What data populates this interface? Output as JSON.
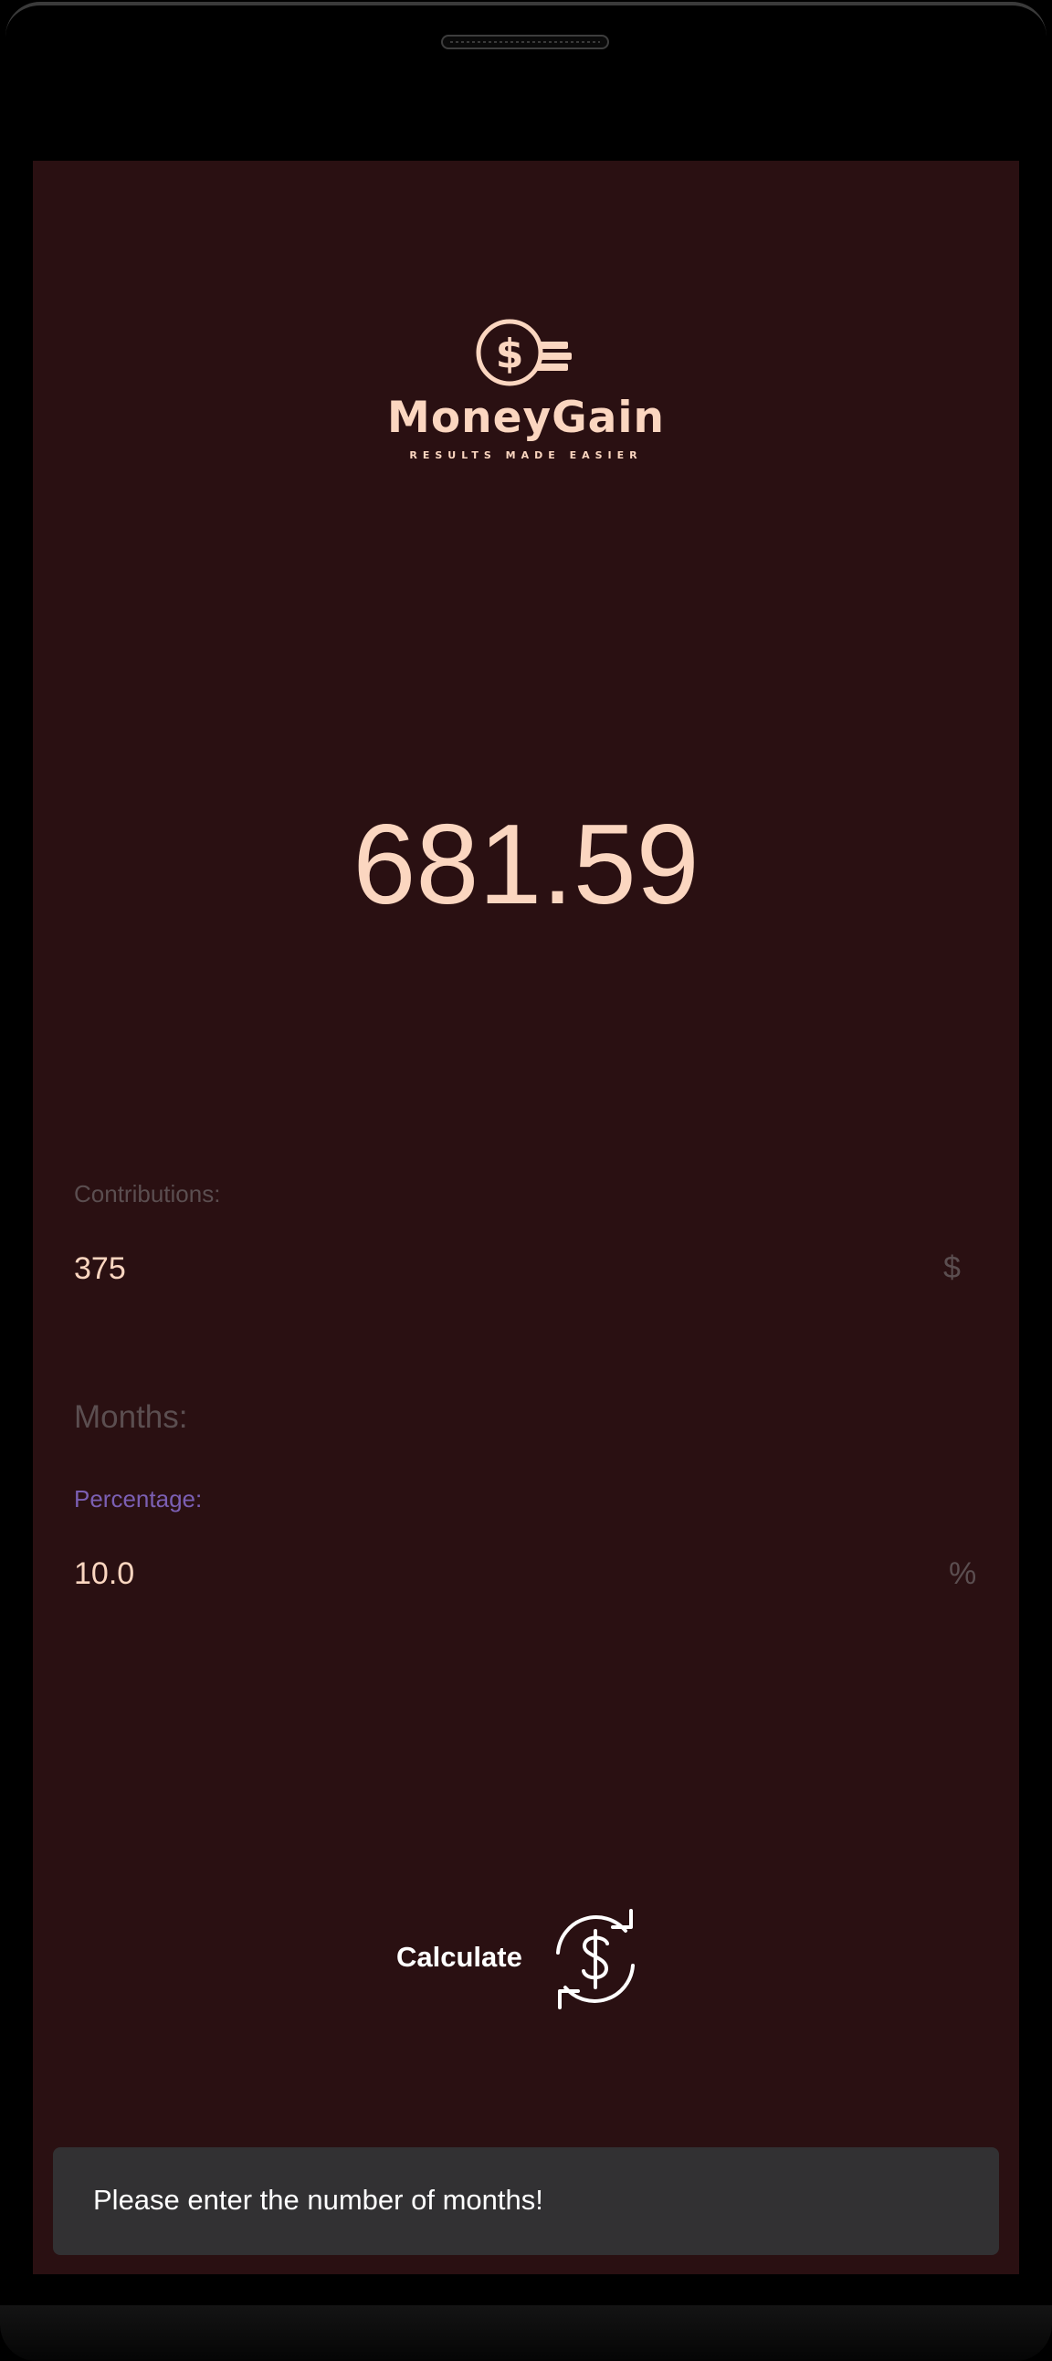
{
  "app": {
    "name": "MoneyGain",
    "tagline": "RESULTS MADE EASIER"
  },
  "result": {
    "value": "681.59"
  },
  "form": {
    "contributions": {
      "label": "Contributions:",
      "value": "375",
      "suffix": "$"
    },
    "months": {
      "label": "Months:"
    },
    "percentage": {
      "label": "Percentage:",
      "value": "10.0",
      "suffix": "%"
    }
  },
  "actions": {
    "calculate_label": "Calculate",
    "calculate_icon": "currency-refresh-icon"
  },
  "snackbar": {
    "message": "Please enter the number of months!"
  },
  "colors": {
    "background": "#2a1012",
    "accent": "#fbd6c0",
    "hint": "#5b4e50",
    "focus": "#7b5fb3",
    "snackbar": "#323133"
  }
}
